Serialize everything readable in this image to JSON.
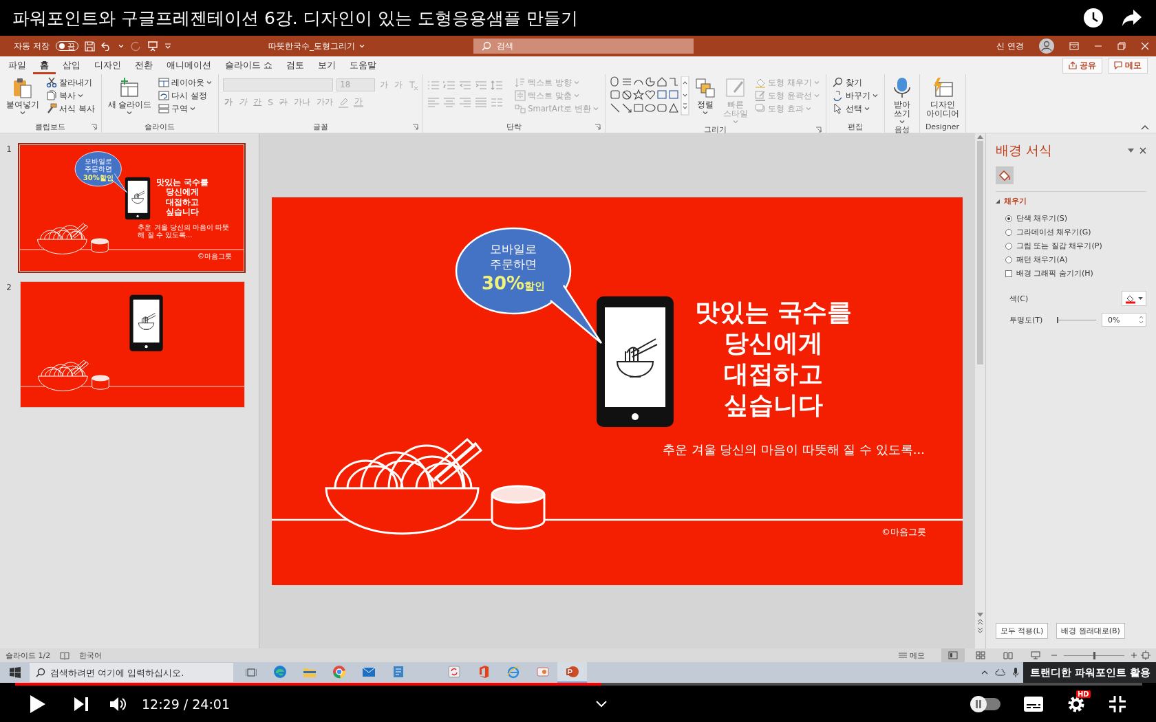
{
  "video_title": "파워포인트와 구글프레젠테이션 6강. 디자인이 있는 도형응용샘플 만들기",
  "titlebar": {
    "autosave_label": "자동 저장",
    "autosave": {
      "on": false,
      "text": "끔"
    },
    "file_name": "따뜻한국수_도형그리기",
    "search_placeholder": "검색",
    "user_name": "신 연경"
  },
  "tabs": [
    {
      "label": "파일",
      "selected": false
    },
    {
      "label": "홈",
      "selected": true
    },
    {
      "label": "삽입",
      "selected": false
    },
    {
      "label": "디자인",
      "selected": false
    },
    {
      "label": "전환",
      "selected": false
    },
    {
      "label": "애니메이션",
      "selected": false
    },
    {
      "label": "슬라이드 쇼",
      "selected": false
    },
    {
      "label": "검토",
      "selected": false
    },
    {
      "label": "보기",
      "selected": false
    },
    {
      "label": "도움말",
      "selected": false
    }
  ],
  "share_button": "공유",
  "comments_button": "메모",
  "ribbon": {
    "groups": [
      {
        "label": "클립보드",
        "launcher": true,
        "items": [
          {
            "kind": "large",
            "label": "붙여넣기",
            "menu": true,
            "disabled": false
          },
          {
            "kind": "small",
            "label": "잘라내기",
            "menu": false,
            "disabled": false
          },
          {
            "kind": "small",
            "label": "복사",
            "menu": true,
            "disabled": false
          },
          {
            "kind": "small",
            "label": "서식 복사",
            "menu": false,
            "disabled": false
          }
        ]
      },
      {
        "label": "슬라이드",
        "launcher": false,
        "items": [
          {
            "kind": "large",
            "label": "새 슬라이드",
            "menu": true,
            "disabled": false
          },
          {
            "kind": "small",
            "label": "레이아웃",
            "menu": true,
            "disabled": false
          },
          {
            "kind": "small",
            "label": "다시 설정",
            "menu": false,
            "disabled": false
          },
          {
            "kind": "small",
            "label": "구역",
            "menu": true,
            "disabled": false
          }
        ]
      },
      {
        "label": "글꼴",
        "launcher": true,
        "items": [
          {
            "kind": "font_controls",
            "font_size": "18",
            "grow_buttons": [
              "가",
              "가"
            ],
            "format_buttons": [
              "가",
              "가",
              "간",
              "S",
              "가",
              "가나",
              "가가"
            ],
            "color_button": "가",
            "disabled": true
          }
        ]
      },
      {
        "label": "단락",
        "launcher": true,
        "items": [
          {
            "kind": "paragraph_controls",
            "disabled": true
          },
          {
            "kind": "small",
            "label": "텍스트 방향",
            "menu": true,
            "disabled": true
          },
          {
            "kind": "small",
            "label": "텍스트 맞춤",
            "menu": true,
            "disabled": true
          },
          {
            "kind": "small",
            "label": "SmartArt로 변환",
            "menu": true,
            "disabled": true
          }
        ]
      },
      {
        "label": "그리기",
        "launcher": true,
        "items": [
          {
            "kind": "shape_gallery"
          },
          {
            "kind": "large",
            "label": "정렬",
            "menu": true,
            "disabled": false
          },
          {
            "kind": "large",
            "label": "빠른\n스타일",
            "menu": true,
            "disabled": true
          },
          {
            "kind": "small",
            "label": "도형 채우기",
            "menu": true,
            "disabled": true
          },
          {
            "kind": "small",
            "label": "도형 윤곽선",
            "menu": true,
            "disabled": true
          },
          {
            "kind": "small",
            "label": "도형 효과",
            "menu": true,
            "disabled": true
          }
        ]
      },
      {
        "label": "편집",
        "launcher": false,
        "items": [
          {
            "kind": "small",
            "label": "찾기",
            "menu": false,
            "disabled": false
          },
          {
            "kind": "small",
            "label": "바꾸기",
            "menu": true,
            "disabled": false
          },
          {
            "kind": "small",
            "label": "선택",
            "menu": true,
            "disabled": false
          }
        ]
      },
      {
        "label": "음성",
        "launcher": false,
        "items": [
          {
            "kind": "large",
            "label": "받아\n쓰기",
            "menu": true,
            "disabled": false
          }
        ]
      },
      {
        "label": "Designer",
        "launcher": false,
        "items": [
          {
            "kind": "large",
            "label": "디자인\n아이디어",
            "menu": false,
            "disabled": false
          }
        ]
      }
    ]
  },
  "slides": [
    {
      "number": "1",
      "selected": true,
      "bubble": {
        "lines": [
          "모바일로",
          "주문하면"
        ],
        "discount": "30%",
        "discount_suffix": "할인"
      },
      "headline": [
        "맛있는 국수를",
        "당신에게",
        "대접하고",
        "싶습니다"
      ],
      "subtitle": "추운 겨울 당신의 마음이 따뜻해 질 수 있도록...",
      "copyright": "©마음그릇"
    },
    {
      "number": "2",
      "selected": false
    }
  ],
  "editor_slide": {
    "bubble": {
      "lines": [
        "모바일로",
        "주문하면"
      ],
      "discount": "30%",
      "discount_suffix": "할인"
    },
    "headline": [
      "맛있는 국수를",
      "당신에게",
      "대접하고",
      "싶습니다"
    ],
    "subtitle": "추운 겨울 당신의 마음이 따뜻해 질 수 있도록...",
    "copyright": "©마음그릇"
  },
  "format_pane": {
    "title": "배경 서식",
    "section": {
      "label": "채우기",
      "expanded": true
    },
    "fill_options": [
      {
        "label": "단색 채우기(S)",
        "selected": true
      },
      {
        "label": "그라데이션 채우기(G)",
        "selected": false
      },
      {
        "label": "그림 또는 질감 채우기(P)",
        "selected": false
      },
      {
        "label": "패턴 채우기(A)",
        "selected": false
      }
    ],
    "hide_graphics": {
      "label": "배경 그래픽 숨기기(H)",
      "checked": false
    },
    "color_label": "색(C)",
    "transparency_label": "투명도(T)",
    "transparency": {
      "level": 0,
      "value": "0%"
    },
    "buttons": [
      "모두 적용(L)",
      "배경 원래대로(B)"
    ]
  },
  "status": {
    "slide_indicator": "슬라이드 1/2",
    "language": "한국어",
    "notes_button": "메모",
    "views": [
      {
        "selected": true
      },
      {
        "selected": false
      },
      {
        "selected": false
      },
      {
        "selected": false
      }
    ],
    "zoom": {
      "level": 0.5
    }
  },
  "taskbar": {
    "search_placeholder": "검색하려면 여기에 입력하십시오.",
    "apps": [
      {
        "active": false
      },
      {
        "active": false
      },
      {
        "active": false
      },
      {
        "active": false
      },
      {
        "active": false
      },
      {
        "active": false
      },
      {
        "active": false
      },
      {
        "active": false
      },
      {
        "active": false
      },
      {
        "active": true
      }
    ],
    "card_teaser": "트랜디한 파워포인트 활용"
  },
  "player": {
    "progress": {
      "level": 0.52
    },
    "time": "12:29 / 24:01",
    "autoplay": {
      "on": false
    },
    "quality_badge": "HD"
  }
}
